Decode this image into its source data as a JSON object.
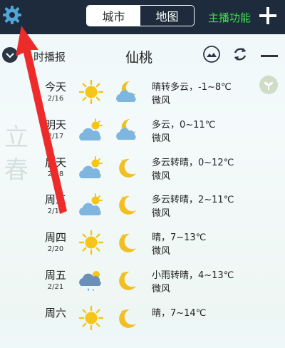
{
  "topbar": {
    "tabs": [
      {
        "label": "城市",
        "active": true
      },
      {
        "label": "地图",
        "active": false
      }
    ],
    "main_function": "主播功能"
  },
  "subheader": {
    "broadcast_label": "时播报",
    "city": "仙桃"
  },
  "side_decoration": "立春",
  "forecast": [
    {
      "day": "今天",
      "date": "2/16",
      "day_icon": "sun-icon",
      "night_icon": "cloudy-moon-icon",
      "desc": "晴转多云，-1~8℃",
      "wind": "微风"
    },
    {
      "day": "明天",
      "date": "2/17",
      "day_icon": "partly-cloudy-icon",
      "night_icon": "cloudy-moon-icon",
      "desc": "多云，0~11℃",
      "wind": "微风"
    },
    {
      "day": "后天",
      "date": "2/18",
      "day_icon": "partly-cloudy-icon",
      "night_icon": "moon-icon",
      "desc": "多云转晴，0~12℃",
      "wind": "微风"
    },
    {
      "day": "周三",
      "date": "2/19",
      "day_icon": "partly-cloudy-icon",
      "night_icon": "moon-icon",
      "desc": "多云转晴，2~11℃",
      "wind": "微风"
    },
    {
      "day": "周四",
      "date": "2/20",
      "day_icon": "sun-icon",
      "night_icon": "moon-icon",
      "desc": "晴，7~13℃",
      "wind": "微风"
    },
    {
      "day": "周五",
      "date": "2/21",
      "day_icon": "light-rain-icon",
      "night_icon": "moon-icon",
      "desc": "小雨转晴，4~13℃",
      "wind": "微风"
    },
    {
      "day": "周六",
      "date": "",
      "day_icon": "sun-icon",
      "night_icon": "moon-icon",
      "desc": "晴，7~14℃",
      "wind": ""
    }
  ],
  "colors": {
    "topbar_bg": "#1e2b3c",
    "accent_green": "#3fdc4d",
    "arrow_red": "#ee2b2b",
    "sun": "#f5c518",
    "cloud": "#7fb6e0"
  }
}
